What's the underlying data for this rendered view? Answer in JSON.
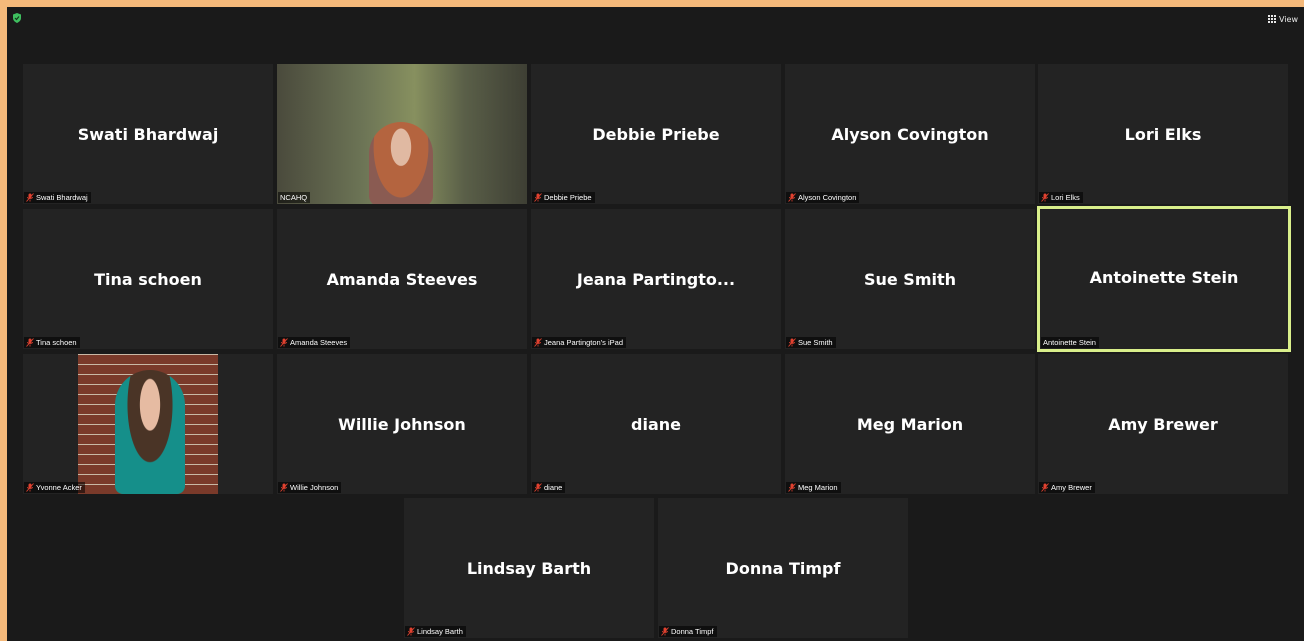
{
  "window": {
    "view_label": "View"
  },
  "icons": {
    "security": "shield-check-icon",
    "view": "grid-icon",
    "muted": "mic-muted-icon"
  },
  "colors": {
    "active_speaker_border": "#d9ef8b",
    "muted_mic": "#e0412f",
    "security": "#3fbf5f"
  },
  "tiles": [
    {
      "name": "Swati Bhardwaj",
      "label": "Swati Bhardwaj",
      "muted": true
    },
    {
      "name": "",
      "label": "NCAHQ",
      "muted": false,
      "video": true
    },
    {
      "name": "Debbie Priebe",
      "label": "Debbie Priebe",
      "muted": true
    },
    {
      "name": "Alyson Covington",
      "label": "Alyson Covington",
      "muted": true
    },
    {
      "name": "Lori Elks",
      "label": "Lori Elks",
      "muted": true
    },
    {
      "name": "Tina schoen",
      "label": "Tina schoen",
      "muted": true
    },
    {
      "name": "Amanda Steeves",
      "label": "Amanda Steeves",
      "muted": true
    },
    {
      "name": "Jeana  Partingto...",
      "label": "Jeana Partington's iPad",
      "muted": true
    },
    {
      "name": "Sue Smith",
      "label": "Sue Smith",
      "muted": true
    },
    {
      "name": "Antoinette Stein",
      "label": "Antoinette Stein",
      "muted": false,
      "active": true
    },
    {
      "name": "",
      "label": "Yvonne Acker",
      "muted": true,
      "video": true
    },
    {
      "name": "Willie Johnson",
      "label": "Willie Johnson",
      "muted": true
    },
    {
      "name": "diane",
      "label": "diane",
      "muted": true
    },
    {
      "name": "Meg Marion",
      "label": "Meg Marion",
      "muted": true
    },
    {
      "name": "Amy Brewer",
      "label": "Amy Brewer",
      "muted": true
    },
    {
      "name": "Lindsay Barth",
      "label": "Lindsay Barth",
      "muted": true
    },
    {
      "name": "Donna Timpf",
      "label": "Donna Timpf",
      "muted": true
    }
  ]
}
